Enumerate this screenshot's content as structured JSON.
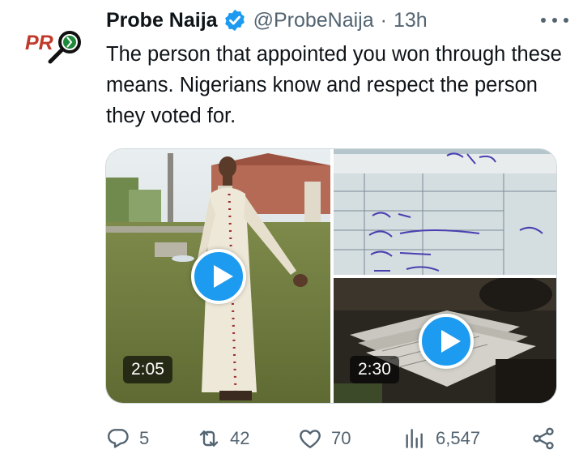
{
  "author": {
    "name": "Probe Naija",
    "handle": "@ProbeNaija",
    "separator": "·",
    "time": "13h",
    "avatar_logo_text": "PRO",
    "verified_color": "#1d9bf0"
  },
  "tweet": {
    "text": "The person that appointed you won through these means. Nigerians know and respect the person they voted for."
  },
  "media": [
    {
      "kind": "video",
      "subject": "priest-in-white-cassock",
      "duration": "2:05"
    },
    {
      "kind": "image",
      "subject": "result-sheet-closeup"
    },
    {
      "kind": "video",
      "subject": "ballot-papers-on-table",
      "duration": "2:30"
    }
  ],
  "actions": {
    "replies": "5",
    "reposts": "42",
    "likes": "70",
    "views": "6,547"
  },
  "colors": {
    "accent": "#1d9bf0",
    "text": "#0f1419",
    "muted": "#536471",
    "border": "#cfd9de"
  },
  "icons": [
    "verified-badge-icon",
    "more-icon",
    "play-icon",
    "reply-icon",
    "repost-icon",
    "like-icon",
    "views-icon",
    "share-icon"
  ]
}
